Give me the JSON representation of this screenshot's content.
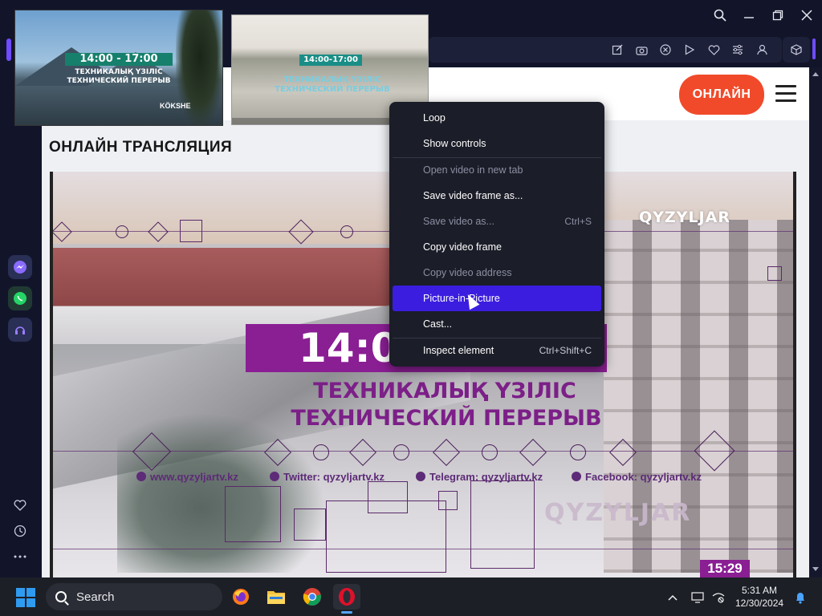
{
  "window": {
    "controls": [
      "Search",
      "Minimize",
      "Maximize",
      "Close"
    ]
  },
  "toolbar": {
    "icons": [
      "compose-icon",
      "camera-icon",
      "close-circle-icon",
      "play-icon",
      "heart-icon",
      "sliders-icon",
      "user-icon",
      "box-icon"
    ]
  },
  "sidebar": {
    "apps": [
      "messenger-icon",
      "whatsapp-icon",
      "music-icon"
    ],
    "bottom": [
      "heart-icon",
      "history-icon",
      "more-icon"
    ]
  },
  "page": {
    "online_button": "ОНЛАЙН",
    "title": "ОНЛАЙН ТРАНСЛЯЦИЯ"
  },
  "video": {
    "time_text": "14:00",
    "line1": "ТЕХНИКАЛЫҚ ҮЗІЛІС",
    "line2": "ТЕХНИЧЕСКИЙ ПЕРЕРЫВ",
    "social": [
      "www.qyzyljartv.kz",
      "Twitter: qyzyljartv.kz",
      "Telegram: qyzyljartv.kz",
      "Facebook: qyzyljartv.kz"
    ],
    "logo": "QYZYLJAR",
    "logo_bottom": "QYZYLJAR",
    "clock": "15:29"
  },
  "pip1": {
    "time": "14:00 - 17:00",
    "line1": "ТЕХНИКАЛЫҚ ҮЗІЛІС",
    "line2": "ТЕХНИЧЕСКИЙ ПЕРЕРЫВ",
    "brand": "KÖKSHE"
  },
  "pip2": {
    "time": "14:00-17:00",
    "line1": "ТЕХНИКАЛЫҚ ҮЗІЛІС",
    "line2": "ТЕХНИЧЕСКИЙ ПЕРЕРЫВ"
  },
  "context_menu": {
    "items": [
      {
        "label": "Loop",
        "shortcut": "",
        "disabled": false
      },
      {
        "label": "Show controls",
        "shortcut": "",
        "disabled": false
      },
      {
        "label": "Open video in new tab",
        "shortcut": "",
        "disabled": true
      },
      {
        "label": "Save video frame as...",
        "shortcut": "",
        "disabled": false
      },
      {
        "label": "Save video as...",
        "shortcut": "Ctrl+S",
        "disabled": true
      },
      {
        "label": "Copy video frame",
        "shortcut": "",
        "disabled": false
      },
      {
        "label": "Copy video address",
        "shortcut": "",
        "disabled": true
      },
      {
        "label": "Picture-in-Picture",
        "shortcut": "",
        "disabled": false
      },
      {
        "label": "Cast...",
        "shortcut": "",
        "disabled": false
      },
      {
        "label": "Inspect element",
        "shortcut": "Ctrl+Shift+C",
        "disabled": false
      }
    ]
  },
  "taskbar": {
    "search_placeholder": "Search",
    "apps": [
      "firefox-icon",
      "file-explorer-icon",
      "chrome-icon",
      "opera-icon"
    ],
    "time": "5:31 AM",
    "date": "12/30/2024"
  },
  "colors": {
    "accent": "#6f4cff",
    "menu_highlight": "#3b1de0",
    "online_button": "#f04a2a",
    "overlay_purple": "#8a1e93"
  }
}
